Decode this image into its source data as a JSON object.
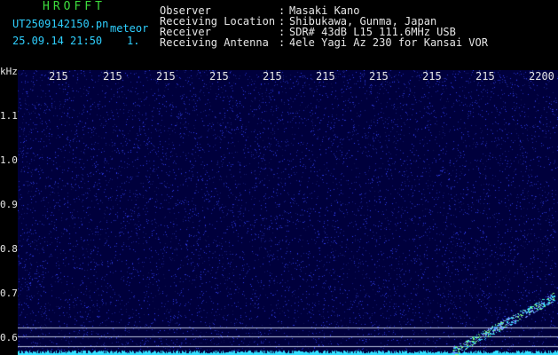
{
  "header": {
    "logo_text": "HROFFT",
    "filename": "UT2509142150.pn",
    "mode": "meteor",
    "datetime": "25.09.14 21:50",
    "page_number": "1.",
    "fields": [
      {
        "label": "Observer",
        "value": "Masaki Kano"
      },
      {
        "label": "Receiving Location",
        "value": "Shibukawa, Gunma, Japan"
      },
      {
        "label": "Receiver",
        "value": "SDR# 43dB L15 111.6MHz USB"
      },
      {
        "label": "Receiving Antenna",
        "value": "4ele Yagi Az 230 for Kansai VOR"
      }
    ]
  },
  "spectrogram": {
    "freq_unit": "kHz",
    "freq_ticks": [
      "1.1",
      "1.0",
      "0.9",
      "0.8",
      "0.7",
      "0.6"
    ],
    "time_ticks": [
      "215",
      "215",
      "215",
      "215",
      "215",
      "215",
      "215",
      "215",
      "215",
      "2200"
    ],
    "colors": {
      "background": "#00003c",
      "noise": "#2a3cff",
      "signal": "#33e0ff",
      "guide_line": "#b8c0d8"
    }
  }
}
